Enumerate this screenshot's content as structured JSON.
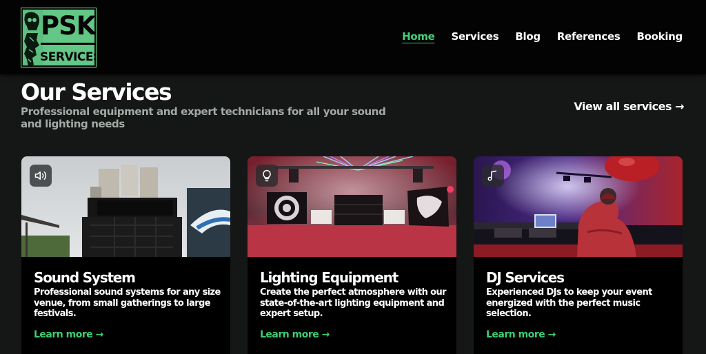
{
  "header": {
    "logo": {
      "top_text": "PSK",
      "bottom_text": "SERVICES"
    },
    "nav": [
      {
        "label": "Home",
        "active": true
      },
      {
        "label": "Services",
        "active": false
      },
      {
        "label": "Blog",
        "active": false
      },
      {
        "label": "References",
        "active": false
      },
      {
        "label": "Booking",
        "active": false
      }
    ]
  },
  "section": {
    "title": "Our Services",
    "subtitle": "Professional equipment and expert technicians for all your sound and lighting needs",
    "view_all": "View all services →"
  },
  "cards": [
    {
      "icon": "speaker-icon",
      "title": "Sound System",
      "description": "Professional sound systems for any size venue, from small gatherings to large festivals.",
      "link": "Learn more →"
    },
    {
      "icon": "lightbulb-icon",
      "title": "Lighting Equipment",
      "description": "Create the perfect atmosphere with our state-of-the-art lighting equipment and expert setup.",
      "link": "Learn more →"
    },
    {
      "icon": "music-note-icon",
      "title": "DJ Services",
      "description": "Experienced DJs to keep your event energized with the perfect music selection.",
      "link": "Learn more →"
    }
  ],
  "colors": {
    "accent": "#45d07a",
    "logo_bg": "#63c886",
    "header_bg": "#020302",
    "page_bg": "#151716",
    "card_bg": "#000000"
  }
}
